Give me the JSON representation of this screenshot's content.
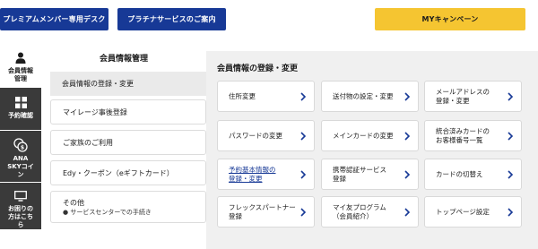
{
  "topbar": {
    "premium_desk": "プレミアムメンバー専用デスク",
    "platinum_info": "プラチナサービスのご案内",
    "my_campaign": "MYキャンペーン"
  },
  "rail": {
    "items": [
      {
        "label": "会員情報管理",
        "icon": "person-icon"
      },
      {
        "label": "予約確認",
        "icon": "grid-icon"
      },
      {
        "label": "ANA SKYコイン",
        "icon": "coin-icon"
      },
      {
        "label": "お困りの方はこちら",
        "icon": "monitor-icon"
      }
    ]
  },
  "sidebar": {
    "title": "会員情報管理",
    "items": [
      {
        "label": "会員情報の登録・変更"
      },
      {
        "label": "マイレージ事後登録"
      },
      {
        "label": "ご家族のご利用"
      },
      {
        "label": "Edy・クーポン（eギフトカード）"
      },
      {
        "label": "その他",
        "sub": "● サービスセンターでの手続き"
      }
    ]
  },
  "main": {
    "title": "会員情報の登録・変更",
    "tiles": [
      {
        "line1": "住所変更",
        "line2": ""
      },
      {
        "line1": "送付物の設定・変更",
        "line2": ""
      },
      {
        "line1": "メールアドレスの",
        "line2": "登録・変更"
      },
      {
        "line1": "パスワードの変更",
        "line2": ""
      },
      {
        "line1": "メインカードの変更",
        "line2": ""
      },
      {
        "line1": "統合済みカードの",
        "line2": "お客様番号一覧"
      },
      {
        "line1": "予約基本情報の",
        "line2": "登録・変更"
      },
      {
        "line1": "携帯認証サービス",
        "line2": "登録"
      },
      {
        "line1": "カードの切替え",
        "line2": ""
      },
      {
        "line1": "フレックスパートナー",
        "line2": "登録"
      },
      {
        "line1": "マイ友プログラム",
        "line2": "（会員紹介）"
      },
      {
        "line1": "トップページ設定",
        "line2": ""
      }
    ]
  },
  "colors": {
    "brand_navy": "#173996",
    "accent_yellow": "#f5c531",
    "rail_dark": "#3a3a3a",
    "content_bg": "#f0f0f0"
  }
}
